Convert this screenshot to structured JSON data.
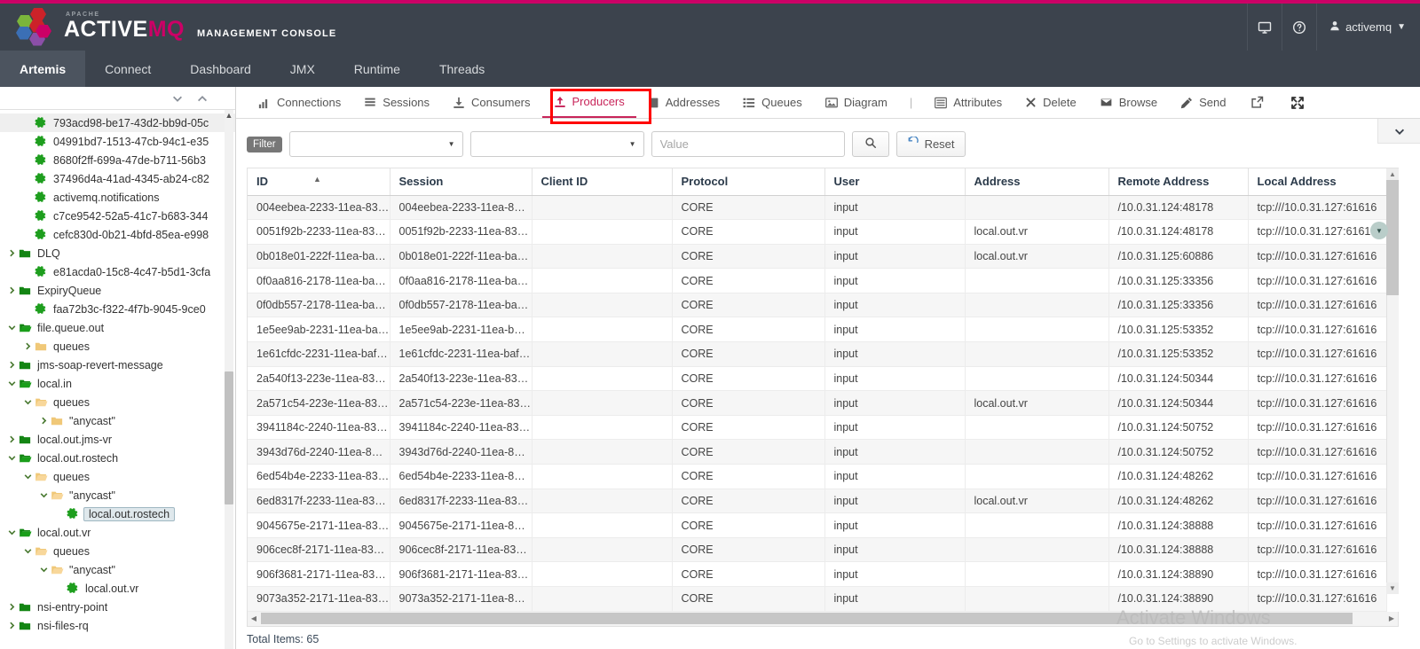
{
  "brand": {
    "apache": "APACHE",
    "name_active": "ACTIVE",
    "name_mq": "MQ",
    "console": "MANAGEMENT CONSOLE",
    "accent": "#cc0066"
  },
  "header": {
    "screen_icon": "monitor-icon",
    "help_icon": "help-circle-icon",
    "user": "activemq"
  },
  "nav": {
    "items": [
      {
        "label": "Artemis",
        "active": true
      },
      {
        "label": "Connect",
        "active": false
      },
      {
        "label": "Dashboard",
        "active": false
      },
      {
        "label": "JMX",
        "active": false
      },
      {
        "label": "Runtime",
        "active": false
      },
      {
        "label": "Threads",
        "active": false
      }
    ]
  },
  "sidebar": {
    "expand_all_icon": "chevron-down-icon",
    "collapse_all_icon": "chevron-up-icon",
    "tree": [
      {
        "label": "793acd98-be17-43d2-bb9d-05c",
        "icon": "gear-icon",
        "indent": 1,
        "twisty": "",
        "highlight": true
      },
      {
        "label": "04991bd7-1513-47cb-94c1-e35",
        "icon": "gear-icon",
        "indent": 1,
        "twisty": ""
      },
      {
        "label": "8680f2ff-699a-47de-b711-56b3",
        "icon": "gear-icon",
        "indent": 1,
        "twisty": ""
      },
      {
        "label": "37496d4a-41ad-4345-ab24-c82",
        "icon": "gear-icon",
        "indent": 1,
        "twisty": ""
      },
      {
        "label": "activemq.notifications",
        "icon": "gear-icon",
        "indent": 1,
        "twisty": ""
      },
      {
        "label": "c7ce9542-52a5-41c7-b683-344",
        "icon": "gear-icon",
        "indent": 1,
        "twisty": ""
      },
      {
        "label": "cefc830d-0b21-4bfd-85ea-e998",
        "icon": "gear-icon",
        "indent": 1,
        "twisty": ""
      },
      {
        "label": "DLQ",
        "icon": "folder-closed-icon",
        "indent": 0,
        "twisty": "right"
      },
      {
        "label": "e81acda0-15c8-4c47-b5d1-3cfa",
        "icon": "gear-icon",
        "indent": 1,
        "twisty": ""
      },
      {
        "label": "ExpiryQueue",
        "icon": "folder-closed-icon",
        "indent": 0,
        "twisty": "right"
      },
      {
        "label": "faa72b3c-f322-4f7b-9045-9ce0",
        "icon": "gear-icon",
        "indent": 1,
        "twisty": ""
      },
      {
        "label": "file.queue.out",
        "icon": "folder-open-icon",
        "indent": 0,
        "twisty": "down"
      },
      {
        "label": "queues",
        "icon": "folder-closed-tan-icon",
        "indent": 1,
        "twisty": "right"
      },
      {
        "label": "jms-soap-revert-message",
        "icon": "folder-closed-icon",
        "indent": 0,
        "twisty": "right"
      },
      {
        "label": "local.in",
        "icon": "folder-open-icon",
        "indent": 0,
        "twisty": "down"
      },
      {
        "label": "queues",
        "icon": "folder-open-tan-icon",
        "indent": 1,
        "twisty": "down"
      },
      {
        "label": "\"anycast\"",
        "icon": "folder-closed-tan-icon",
        "indent": 2,
        "twisty": "right"
      },
      {
        "label": "local.out.jms-vr",
        "icon": "folder-closed-icon",
        "indent": 0,
        "twisty": "right"
      },
      {
        "label": "local.out.rostech",
        "icon": "folder-open-icon",
        "indent": 0,
        "twisty": "down"
      },
      {
        "label": "queues",
        "icon": "folder-open-tan-icon",
        "indent": 1,
        "twisty": "down"
      },
      {
        "label": "\"anycast\"",
        "icon": "folder-open-tan-icon",
        "indent": 2,
        "twisty": "down"
      },
      {
        "label": "local.out.rostech",
        "icon": "gear-icon",
        "indent": 3,
        "twisty": "",
        "selected": true
      },
      {
        "label": "local.out.vr",
        "icon": "folder-open-icon",
        "indent": 0,
        "twisty": "down"
      },
      {
        "label": "queues",
        "icon": "folder-open-tan-icon",
        "indent": 1,
        "twisty": "down"
      },
      {
        "label": "\"anycast\"",
        "icon": "folder-open-tan-icon",
        "indent": 2,
        "twisty": "down"
      },
      {
        "label": "local.out.vr",
        "icon": "gear-icon",
        "indent": 3,
        "twisty": ""
      },
      {
        "label": "nsi-entry-point",
        "icon": "folder-closed-icon",
        "indent": 0,
        "twisty": "right"
      },
      {
        "label": "nsi-files-rq",
        "icon": "folder-closed-icon",
        "indent": 0,
        "twisty": "right"
      }
    ]
  },
  "toolbar": {
    "items": [
      {
        "label": "Connections",
        "icon": "bar-chart-icon",
        "active": false
      },
      {
        "label": "Sessions",
        "icon": "list-icon",
        "active": false
      },
      {
        "label": "Consumers",
        "icon": "download-icon",
        "active": false
      },
      {
        "label": "Producers",
        "icon": "upload-icon",
        "active": true
      },
      {
        "label": "Addresses",
        "icon": "book-icon",
        "active": false
      },
      {
        "label": "Queues",
        "icon": "list-ul-icon",
        "active": false
      },
      {
        "label": "Diagram",
        "icon": "image-icon",
        "active": false
      }
    ],
    "separator": "|",
    "items_right": [
      {
        "label": "Attributes",
        "icon": "list-alt-icon"
      },
      {
        "label": "Delete",
        "icon": "x-icon"
      },
      {
        "label": "Browse",
        "icon": "envelope-icon"
      },
      {
        "label": "Send",
        "icon": "pencil-icon"
      }
    ],
    "external_link_icon": "external-link-icon",
    "expand_icon": "expand-arrows-icon",
    "collapse_icon": "chevron-down-icon"
  },
  "filter": {
    "label": "Filter",
    "field_select": "",
    "op_select": "",
    "value_placeholder": "Value",
    "value": "",
    "search_icon": "search-icon",
    "reset_label": "Reset",
    "reset_icon": "refresh-icon"
  },
  "table": {
    "columns": [
      "ID",
      "Session",
      "Client ID",
      "Protocol",
      "User",
      "Address",
      "Remote Address",
      "Local Address"
    ],
    "sorted_column": "ID",
    "sort_direction": "asc",
    "rows": [
      {
        "id": "004eebea-2233-11ea-83…",
        "session": "004eebea-2233-11ea-83…",
        "client_id": "",
        "protocol": "CORE",
        "user": "input",
        "address": "",
        "remote_address": "/10.0.31.124:48178",
        "local_address": "tcp:///10.0.31.127:61616"
      },
      {
        "id": "0051f92b-2233-11ea-83…",
        "session": "0051f92b-2233-11ea-83…",
        "client_id": "",
        "protocol": "CORE",
        "user": "input",
        "address": "local.out.vr",
        "remote_address": "/10.0.31.124:48178",
        "local_address": "tcp:///10.0.31.127:61616"
      },
      {
        "id": "0b018e01-222f-11ea-ba…",
        "session": "0b018e01-222f-11ea-ba…",
        "client_id": "",
        "protocol": "CORE",
        "user": "input",
        "address": "local.out.vr",
        "remote_address": "/10.0.31.125:60886",
        "local_address": "tcp:///10.0.31.127:61616"
      },
      {
        "id": "0f0aa816-2178-11ea-ba…",
        "session": "0f0aa816-2178-11ea-ba…",
        "client_id": "",
        "protocol": "CORE",
        "user": "input",
        "address": "",
        "remote_address": "/10.0.31.125:33356",
        "local_address": "tcp:///10.0.31.127:61616"
      },
      {
        "id": "0f0db557-2178-11ea-ba…",
        "session": "0f0db557-2178-11ea-ba…",
        "client_id": "",
        "protocol": "CORE",
        "user": "input",
        "address": "",
        "remote_address": "/10.0.31.125:33356",
        "local_address": "tcp:///10.0.31.127:61616"
      },
      {
        "id": "1e5ee9ab-2231-11ea-ba…",
        "session": "1e5ee9ab-2231-11ea-ba…",
        "client_id": "",
        "protocol": "CORE",
        "user": "input",
        "address": "",
        "remote_address": "/10.0.31.125:53352",
        "local_address": "tcp:///10.0.31.127:61616"
      },
      {
        "id": "1e61cfdc-2231-11ea-baf…",
        "session": "1e61cfdc-2231-11ea-baf…",
        "client_id": "",
        "protocol": "CORE",
        "user": "input",
        "address": "",
        "remote_address": "/10.0.31.125:53352",
        "local_address": "tcp:///10.0.31.127:61616"
      },
      {
        "id": "2a540f13-223e-11ea-83…",
        "session": "2a540f13-223e-11ea-83…",
        "client_id": "",
        "protocol": "CORE",
        "user": "input",
        "address": "",
        "remote_address": "/10.0.31.124:50344",
        "local_address": "tcp:///10.0.31.127:61616"
      },
      {
        "id": "2a571c54-223e-11ea-83…",
        "session": "2a571c54-223e-11ea-83…",
        "client_id": "",
        "protocol": "CORE",
        "user": "input",
        "address": "local.out.vr",
        "remote_address": "/10.0.31.124:50344",
        "local_address": "tcp:///10.0.31.127:61616"
      },
      {
        "id": "3941184c-2240-11ea-83…",
        "session": "3941184c-2240-11ea-83…",
        "client_id": "",
        "protocol": "CORE",
        "user": "input",
        "address": "",
        "remote_address": "/10.0.31.124:50752",
        "local_address": "tcp:///10.0.31.127:61616"
      },
      {
        "id": "3943d76d-2240-11ea-8…",
        "session": "3943d76d-2240-11ea-8…",
        "client_id": "",
        "protocol": "CORE",
        "user": "input",
        "address": "",
        "remote_address": "/10.0.31.124:50752",
        "local_address": "tcp:///10.0.31.127:61616"
      },
      {
        "id": "6ed54b4e-2233-11ea-83…",
        "session": "6ed54b4e-2233-11ea-83…",
        "client_id": "",
        "protocol": "CORE",
        "user": "input",
        "address": "",
        "remote_address": "/10.0.31.124:48262",
        "local_address": "tcp:///10.0.31.127:61616"
      },
      {
        "id": "6ed8317f-2233-11ea-83…",
        "session": "6ed8317f-2233-11ea-83…",
        "client_id": "",
        "protocol": "CORE",
        "user": "input",
        "address": "local.out.vr",
        "remote_address": "/10.0.31.124:48262",
        "local_address": "tcp:///10.0.31.127:61616"
      },
      {
        "id": "9045675e-2171-11ea-83…",
        "session": "9045675e-2171-11ea-83…",
        "client_id": "",
        "protocol": "CORE",
        "user": "input",
        "address": "",
        "remote_address": "/10.0.31.124:38888",
        "local_address": "tcp:///10.0.31.127:61616"
      },
      {
        "id": "906cec8f-2171-11ea-83…",
        "session": "906cec8f-2171-11ea-83…",
        "client_id": "",
        "protocol": "CORE",
        "user": "input",
        "address": "",
        "remote_address": "/10.0.31.124:38888",
        "local_address": "tcp:///10.0.31.127:61616"
      },
      {
        "id": "906f3681-2171-11ea-83…",
        "session": "906f3681-2171-11ea-83…",
        "client_id": "",
        "protocol": "CORE",
        "user": "input",
        "address": "",
        "remote_address": "/10.0.31.124:38890",
        "local_address": "tcp:///10.0.31.127:61616"
      },
      {
        "id": "9073a352-2171-11ea-83…",
        "session": "9073a352-2171-11ea-83…",
        "client_id": "",
        "protocol": "CORE",
        "user": "input",
        "address": "",
        "remote_address": "/10.0.31.124:38890",
        "local_address": "tcp:///10.0.31.127:61616"
      }
    ],
    "total_items": "Total Items: 65"
  },
  "watermark": {
    "line1": "Activate Windows",
    "line2": "Go to Settings to activate Windows."
  }
}
